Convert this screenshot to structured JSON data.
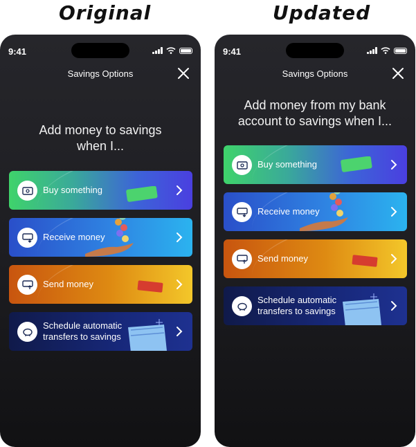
{
  "headings": {
    "original": "Original",
    "updated": "Updated"
  },
  "colors": {
    "background": "#1f1f23",
    "card_buy": "#3fd36b-#4a3fe0",
    "card_receive": "#2a4fc9-#2bb3ef",
    "card_send": "#c8550f-#f3c72a",
    "card_schedule": "#101a4a-#1e3190"
  },
  "original": {
    "status_time": "9:41",
    "sheet_title": "Savings Options",
    "prompt_line1": "Add money to savings",
    "prompt_line2": "when I...",
    "options": [
      {
        "icon": "cash-icon",
        "label": "Buy something"
      },
      {
        "icon": "receive-money-icon",
        "label": "Receive money"
      },
      {
        "icon": "send-money-icon",
        "label": "Send money"
      },
      {
        "icon": "piggy-bank-icon",
        "label_line1": "Schedule automatic",
        "label_line2": "transfers to savings"
      }
    ]
  },
  "updated": {
    "status_time": "9:41",
    "sheet_title": "Savings Options",
    "prompt_line1": "Add money from my bank",
    "prompt_line2": "account to savings when I...",
    "options": [
      {
        "icon": "cash-icon",
        "label": "Buy something"
      },
      {
        "icon": "receive-money-icon",
        "label": "Receive money"
      },
      {
        "icon": "send-money-icon",
        "label": "Send money"
      },
      {
        "icon": "piggy-bank-icon",
        "label_line1": "Schedule automatic",
        "label_line2": "transfers to savings"
      }
    ]
  }
}
